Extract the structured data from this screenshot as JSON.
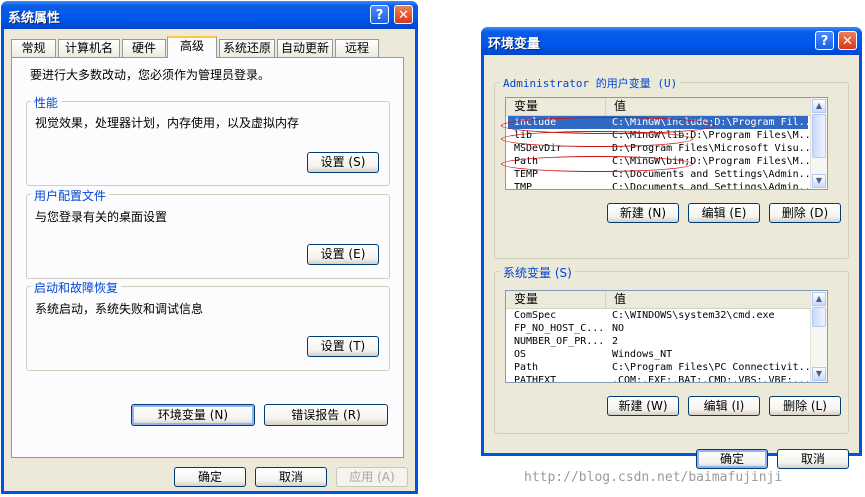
{
  "sysprops": {
    "title": "系统属性",
    "help_btn": "?",
    "close_btn": "✕",
    "tabs": [
      "常规",
      "计算机名",
      "硬件",
      "高级",
      "系统还原",
      "自动更新",
      "远程"
    ],
    "admin_note": "要进行大多数改动，您必须作为管理员登录。",
    "performance": {
      "title": "性能",
      "desc": "视觉效果，处理器计划，内存使用，以及虚拟内存",
      "button": "设置 (S)"
    },
    "user_profiles": {
      "title": "用户配置文件",
      "desc": "与您登录有关的桌面设置",
      "button": "设置 (E)"
    },
    "startup": {
      "title": "启动和故障恢复",
      "desc": "系统启动，系统失败和调试信息",
      "button": "设置 (T)"
    },
    "env_button": "环境变量 (N)",
    "error_button": "错误报告 (R)",
    "ok": "确定",
    "cancel": "取消",
    "apply": "应用 (A)"
  },
  "envvars": {
    "title": "环境变量",
    "help_btn": "?",
    "close_btn": "✕",
    "user_group_title": "Administrator 的用户变量 (U)",
    "sys_group_title": "系统变量 (S)",
    "col_var": "变量",
    "col_val": "值",
    "user_rows": [
      {
        "name": "include",
        "value": "C:\\MinGW\\include;D:\\Program Fil..."
      },
      {
        "name": "lib",
        "value": "C:\\MinGW\\lib;D:\\Program Files\\M..."
      },
      {
        "name": "MSDevDir",
        "value": "D:\\Program Files\\Microsoft Visu..."
      },
      {
        "name": "Path",
        "value": "C:\\MinGW\\bin;D:\\Program Files\\M..."
      },
      {
        "name": "TEMP",
        "value": "C:\\Documents and Settings\\Admin..."
      },
      {
        "name": "TMP",
        "value": "C:\\Documents and Settings\\Admin..."
      }
    ],
    "sys_rows": [
      {
        "name": "ComSpec",
        "value": "C:\\WINDOWS\\system32\\cmd.exe"
      },
      {
        "name": "FP_NO_HOST_C...",
        "value": "NO"
      },
      {
        "name": "NUMBER_OF_PR...",
        "value": "2"
      },
      {
        "name": "OS",
        "value": "Windows_NT"
      },
      {
        "name": "Path",
        "value": "C:\\Program Files\\PC Connectivit..."
      },
      {
        "name": "PATHEXT",
        "value": ".COM;.EXE;.BAT;.CMD;.VBS;.VBE;..."
      }
    ],
    "new_user": "新建 (N)",
    "edit_user": "编辑 (E)",
    "delete_user": "删除 (D)",
    "new_sys": "新建 (W)",
    "edit_sys": "编辑 (I)",
    "delete_sys": "删除 (L)",
    "ok": "确定",
    "cancel": "取消"
  },
  "watermark": "http://blog.csdn.net/baimafujinji"
}
